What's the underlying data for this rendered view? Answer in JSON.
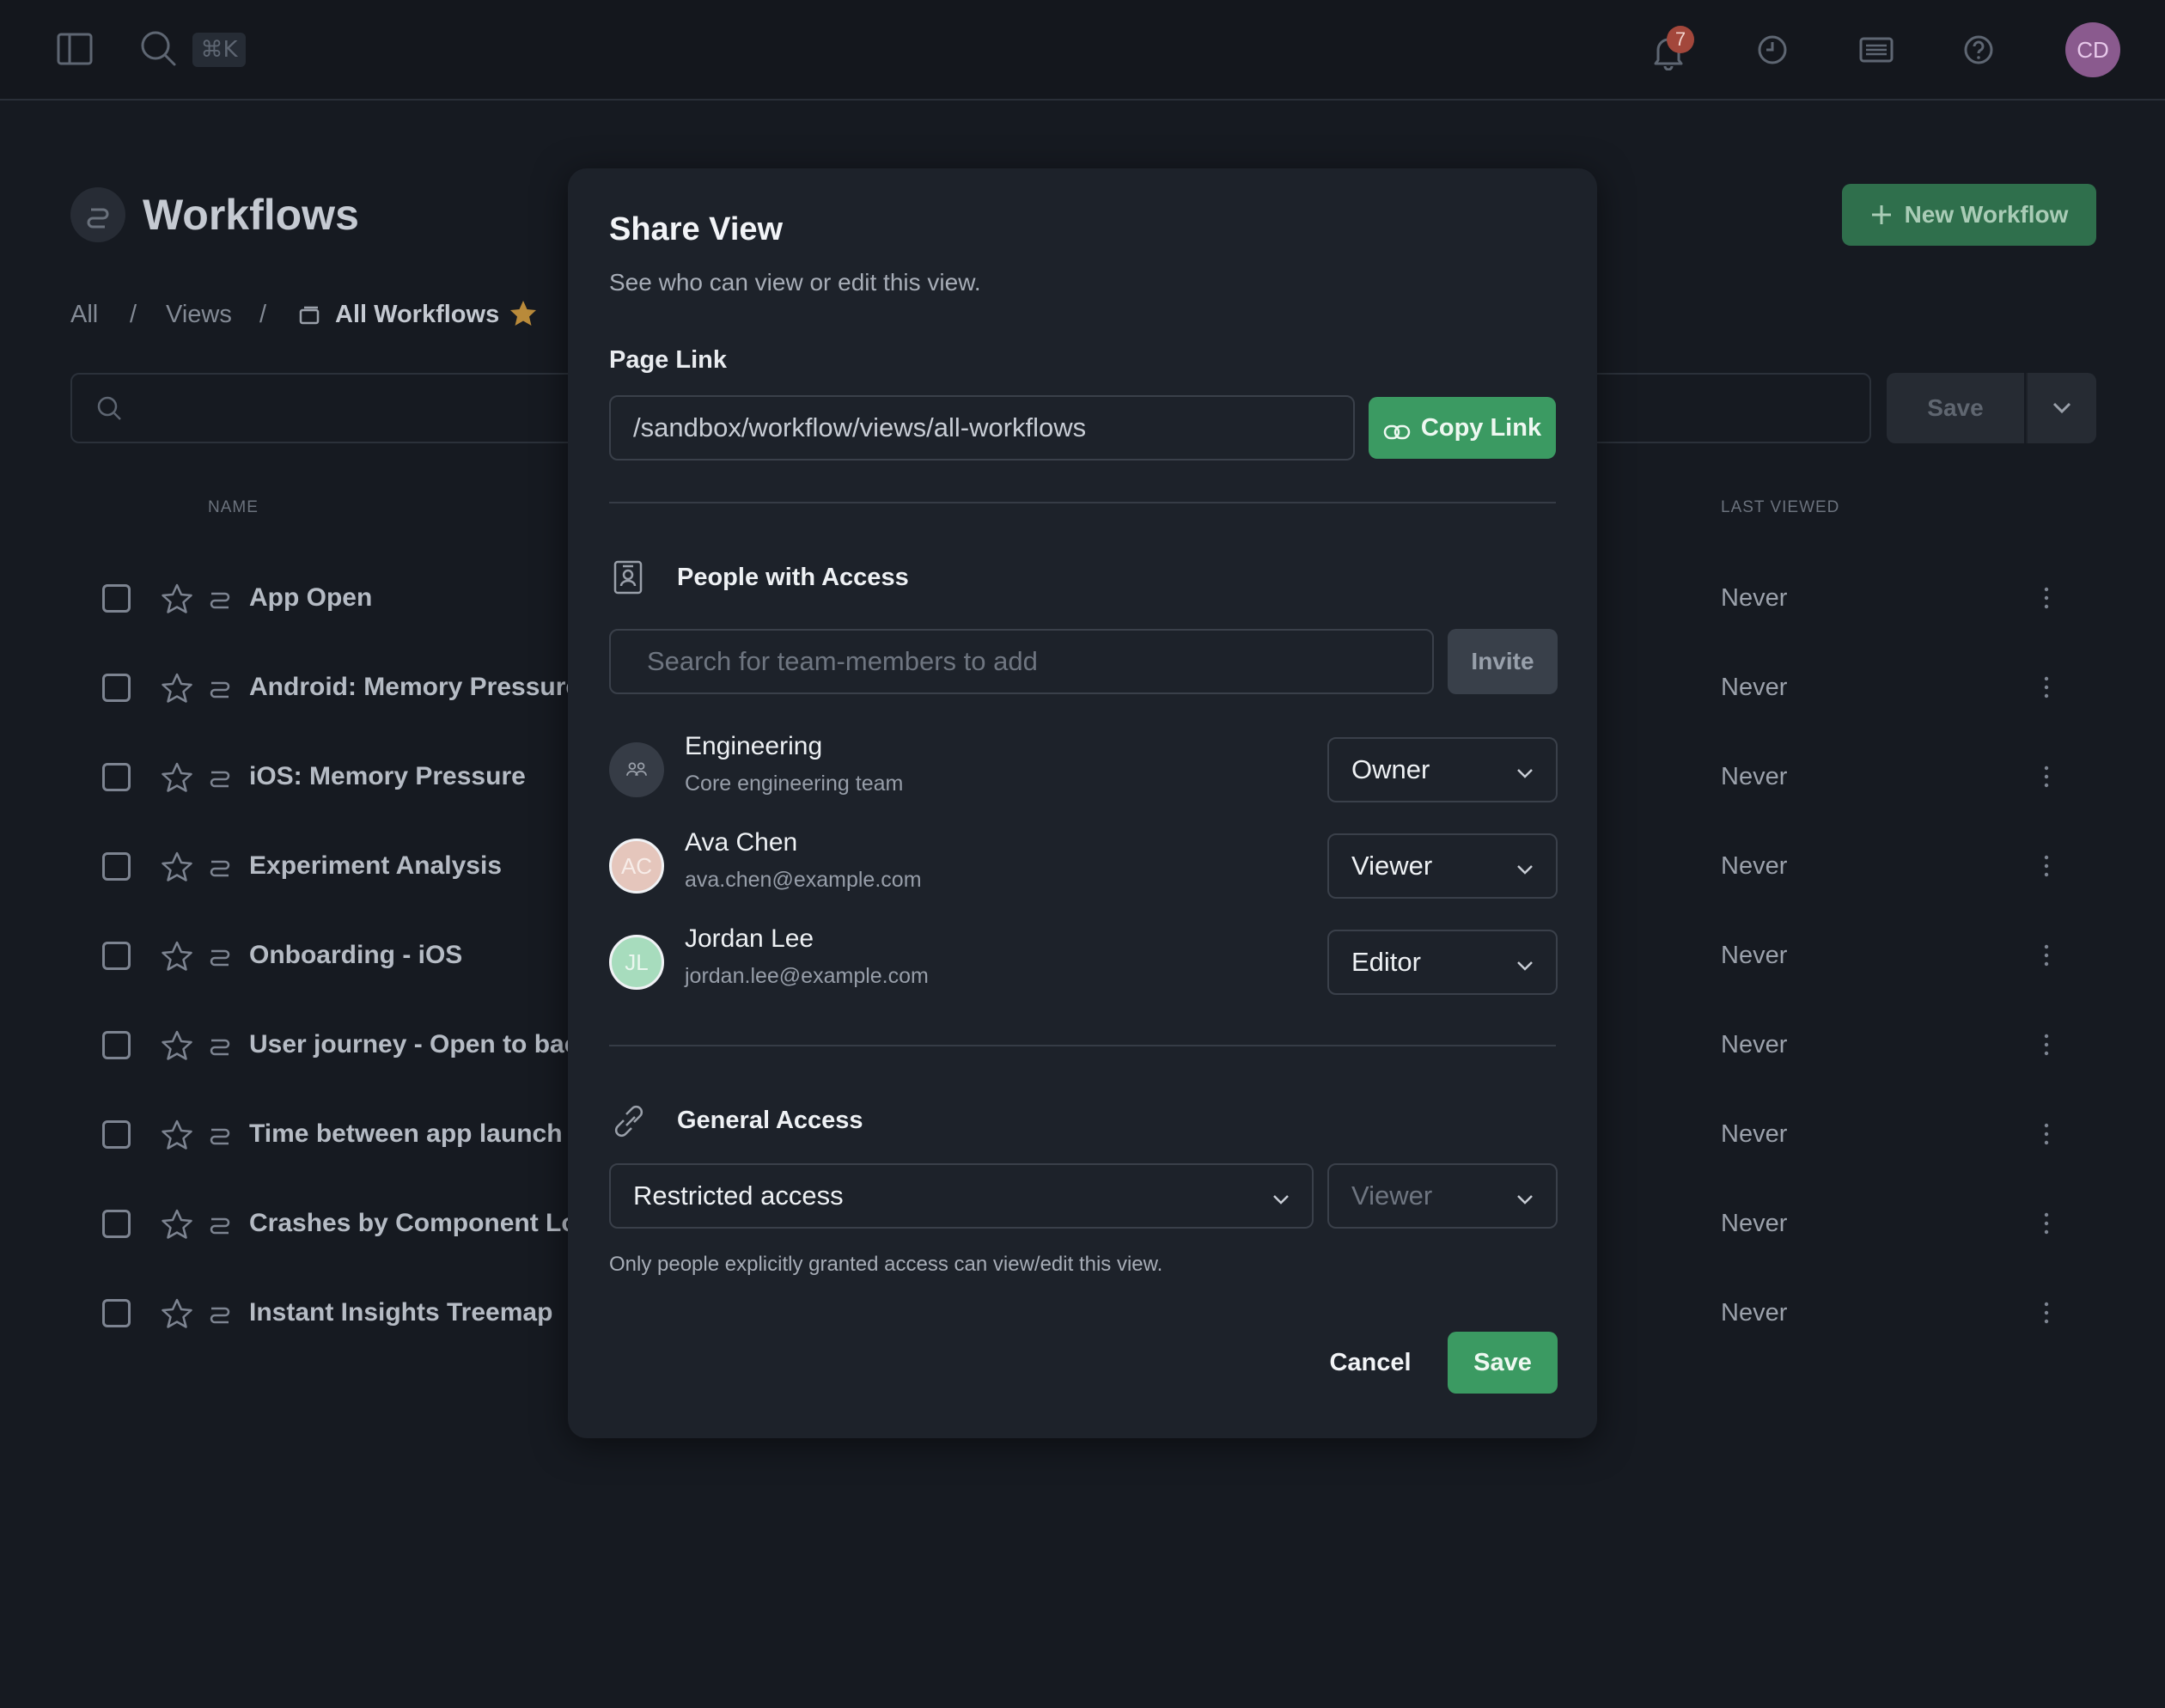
{
  "topbar": {
    "search_shortcut": "⌘K",
    "notification_count": "7",
    "user_initials": "CD"
  },
  "page": {
    "title": "Workflows",
    "new_button": "New Workflow",
    "breadcrumb": [
      "All",
      "/",
      "Views",
      "/",
      "All Workflows"
    ],
    "save_label": "Save",
    "columns": {
      "name": "NAME",
      "last_viewed": "LAST VIEWED"
    },
    "rows": [
      {
        "name": "App Open",
        "last_viewed": "Never"
      },
      {
        "name": "Android: Memory Pressure",
        "last_viewed": "Never"
      },
      {
        "name": "iOS: Memory Pressure",
        "last_viewed": "Never"
      },
      {
        "name": "Experiment Analysis",
        "last_viewed": "Never"
      },
      {
        "name": "Onboarding - iOS",
        "last_viewed": "Never"
      },
      {
        "name": "User journey - Open to backg",
        "last_viewed": "Never"
      },
      {
        "name": "Time between app launch ar",
        "last_viewed": "Never"
      },
      {
        "name": "Crashes by Component Loca",
        "last_viewed": "Never"
      },
      {
        "name": "Instant Insights Treemap",
        "last_viewed": "Never"
      }
    ]
  },
  "modal": {
    "title": "Share View",
    "subtitle": "See who can view or edit this view.",
    "page_link_label": "Page Link",
    "page_link_value": "/sandbox/workflow/views/all-workflows",
    "copy_link": "Copy Link",
    "people_title": "People with Access",
    "search_placeholder": "Search for team-members to add",
    "invite": "Invite",
    "people": [
      {
        "name": "Engineering",
        "detail": "Core engineering team",
        "role": "Owner",
        "initials": ""
      },
      {
        "name": "Ava Chen",
        "detail": "ava.chen@example.com",
        "role": "Viewer",
        "initials": "AC"
      },
      {
        "name": "Jordan Lee",
        "detail": "jordan.lee@example.com",
        "role": "Editor",
        "initials": "JL"
      }
    ],
    "general_title": "General Access",
    "general_access": "Restricted access",
    "general_role": "Viewer",
    "general_note": "Only people explicitly granted access can view/edit this view.",
    "cancel": "Cancel",
    "save": "Save"
  },
  "colors": {
    "accent_green": "#3b9a62",
    "badge_red": "#a3473b",
    "avatar_purple": "#8a5a8e",
    "favorite_star": "#b98a3a"
  }
}
